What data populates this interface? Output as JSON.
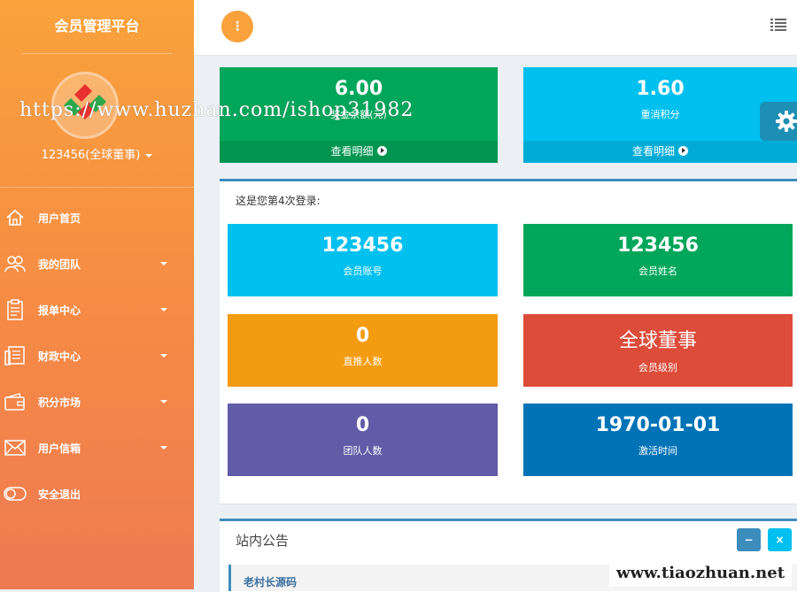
{
  "sidebar": {
    "brand": "会员管理平台",
    "username": "123456(全球董事)",
    "items": [
      {
        "label": "用户首页",
        "icon": "home-icon",
        "has_caret": false
      },
      {
        "label": "我的团队",
        "icon": "users-icon",
        "has_caret": true
      },
      {
        "label": "报单中心",
        "icon": "clipboard-icon",
        "has_caret": true
      },
      {
        "label": "财政中心",
        "icon": "ledger-icon",
        "has_caret": true
      },
      {
        "label": "积分市场",
        "icon": "wallet-icon",
        "has_caret": true
      },
      {
        "label": "用户信箱",
        "icon": "envelope-icon",
        "has_caret": true
      },
      {
        "label": "安全退出",
        "icon": "toggle-icon",
        "has_caret": false
      }
    ]
  },
  "topbar": {
    "toggle_label": "⋮"
  },
  "top_stats": [
    {
      "value": "6.00",
      "label": "奖金余额(元)",
      "footer": "查看明细",
      "color": "#00a65a"
    },
    {
      "value": "1.60",
      "label": "重消积分",
      "footer": "查看明细",
      "color": "#00c0ef"
    }
  ],
  "login_panel": {
    "message": "这是您第4次登录:",
    "cards": [
      {
        "value": "123456",
        "label": "会员账号",
        "color": "#00c0ef"
      },
      {
        "value": "123456",
        "label": "会员姓名",
        "color": "#00a65a"
      },
      {
        "value": "0",
        "label": "直推人数",
        "color": "#f39c12"
      },
      {
        "value": "全球董事",
        "label": "会员级别",
        "color": "#dd4b39"
      },
      {
        "value": "0",
        "label": "团队人数",
        "color": "#605ca8"
      },
      {
        "value": "1970-01-01",
        "label": "激活时间",
        "color": "#0073b7"
      }
    ]
  },
  "notice_panel": {
    "title": "站内公告",
    "minimize_label": "−",
    "close_label": "×",
    "items": [
      "老村长源码"
    ]
  },
  "watermarks": {
    "top": "https://www.huzhan.com/ishop31982",
    "bottom": "www.tiaozhuan.net"
  }
}
